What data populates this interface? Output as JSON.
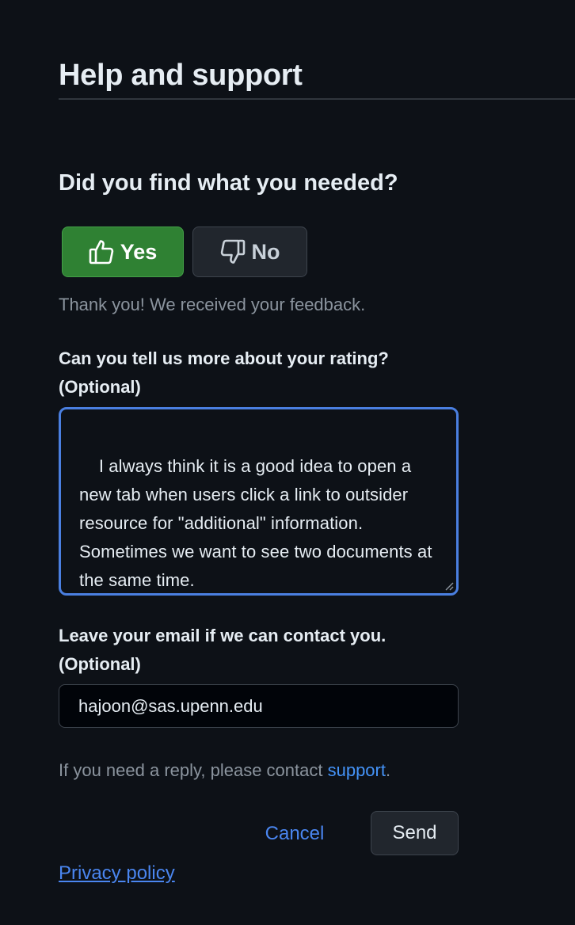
{
  "header": {
    "title": "Help and support"
  },
  "feedback": {
    "question": "Did you find what you needed?",
    "yes_label": "Yes",
    "no_label": "No",
    "selected": "Yes",
    "confirmation": "Thank you! We received your feedback."
  },
  "rating_details": {
    "label_line1": "Can you tell us more about your rating?",
    "label_line2": "(Optional)",
    "value": "I always think it is a good idea to open a new tab when users click a link to outsider resource for \"additional\" information. Sometimes we want to see two documents at the same time."
  },
  "email": {
    "label_line1": "Leave your email if we can contact you.",
    "label_line2": "(Optional)",
    "value": "hajoon@sas.upenn.edu"
  },
  "reply_note": {
    "prefix": "If you need a reply, please contact ",
    "link_text": "support",
    "suffix": "."
  },
  "actions": {
    "cancel_label": "Cancel",
    "send_label": "Send"
  },
  "footer": {
    "privacy_label": "Privacy policy"
  },
  "colors": {
    "background": "#0d1117",
    "yes_button": "#2f8133",
    "focus_border": "#4a7fe0",
    "link": "#4493f8"
  },
  "icons": {
    "yes": "thumbs-up-icon",
    "no": "thumbs-down-icon"
  }
}
